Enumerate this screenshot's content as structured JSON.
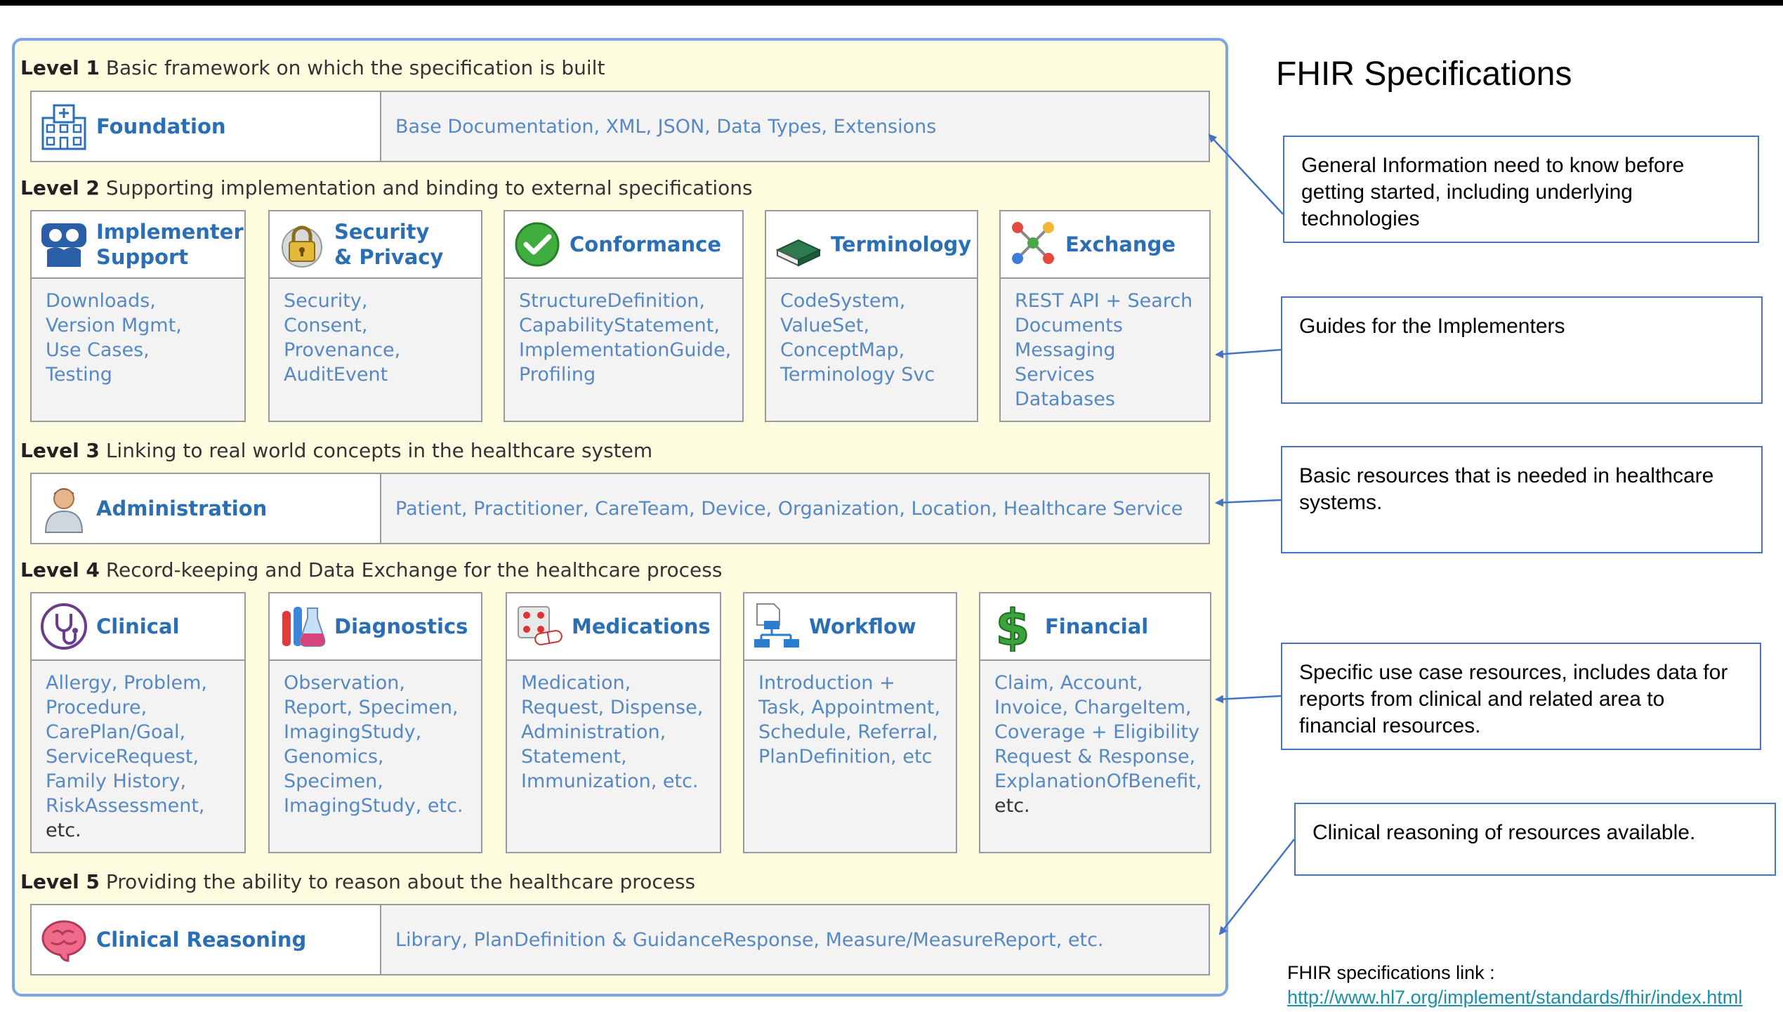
{
  "heading": "FHIR Specifications",
  "levels": [
    {
      "num": "Level 1",
      "text": "Basic framework on which the specification is built"
    },
    {
      "num": "Level 2",
      "text": "Supporting implementation and binding to external specifications"
    },
    {
      "num": "Level 3",
      "text": "Linking to real world concepts in the healthcare system"
    },
    {
      "num": "Level 4",
      "text": "Record-keeping and Data Exchange for the healthcare process"
    },
    {
      "num": "Level 5",
      "text": "Providing the ability to reason about the healthcare process"
    }
  ],
  "foundation": {
    "label": "Foundation",
    "icon": "building-icon",
    "items": "Base Documentation, XML, JSON, Data Types, Extensions"
  },
  "level2": [
    {
      "label1": "Implementer",
      "label2": "Support",
      "icon": "people-icon",
      "lines": [
        "Downloads,",
        "Version Mgmt,",
        "Use Cases,",
        "Testing"
      ]
    },
    {
      "label1": "Security",
      "label2": "& Privacy",
      "icon": "lock-icon",
      "lines": [
        "Security,",
        "Consent,",
        "Provenance,",
        "AuditEvent"
      ]
    },
    {
      "label1": "Conformance",
      "label2": "",
      "icon": "check-icon",
      "lines": [
        "StructureDefinition,",
        "CapabilityStatement,",
        "ImplementationGuide,",
        "Profiling"
      ]
    },
    {
      "label1": "Terminology",
      "label2": "",
      "icon": "book-icon",
      "lines": [
        "CodeSystem,",
        "ValueSet,",
        "ConceptMap,",
        "Terminology Svc"
      ]
    },
    {
      "label1": "Exchange",
      "label2": "",
      "icon": "exchange-icon",
      "lines": [
        "REST API + Search",
        "Documents",
        "Messaging",
        "Services",
        "Databases"
      ]
    }
  ],
  "administration": {
    "label": "Administration",
    "icon": "person-icon",
    "items": "Patient, Practitioner, CareTeam, Device, Organization, Location, Healthcare Service"
  },
  "level4": [
    {
      "label": "Clinical",
      "icon": "stethoscope-icon",
      "lines": [
        "Allergy, Problem,",
        "Procedure,",
        "CarePlan/Goal,",
        "ServiceRequest,",
        "Family History,",
        "RiskAssessment,",
        "etc."
      ]
    },
    {
      "label": "Diagnostics",
      "icon": "flask-icon",
      "lines": [
        "Observation,",
        "Report, Specimen,",
        "ImagingStudy,",
        "Genomics,",
        "Specimen,",
        "ImagingStudy, etc."
      ]
    },
    {
      "label": "Medications",
      "icon": "pills-icon",
      "lines": [
        "Medication,",
        "Request, Dispense,",
        "Administration,",
        "Statement,",
        "Immunization, etc."
      ]
    },
    {
      "label": "Workflow",
      "icon": "flowchart-icon",
      "lines": [
        "Introduction +",
        "Task, Appointment,",
        "Schedule, Referral,",
        "PlanDefinition, etc"
      ]
    },
    {
      "label": "Financial",
      "icon": "dollar-icon",
      "lines": [
        "Claim, Account,",
        "Invoice, ChargeItem,",
        "Coverage + Eligibility",
        "Request & Response,",
        "ExplanationOfBenefit,",
        "etc."
      ]
    }
  ],
  "reasoning": {
    "label": "Clinical Reasoning",
    "icon": "brain-icon",
    "items": "Library, PlanDefinition & GuidanceResponse, Measure/MeasureReport, etc."
  },
  "notes": [
    "General Information need to know before getting started, including underlying technologies",
    "Guides for the Implementers",
    "Basic resources that is needed in healthcare systems.",
    "Specific use case resources, includes data for reports from clinical and related area to financial resources.",
    "Clinical reasoning of resources available."
  ],
  "link_label": "FHIR specifications link :",
  "link_url": "http://www.hl7.org/implement/standards/fhir/index.html",
  "colors": {
    "panel": "#fffde0",
    "panel_border": "#7aa6e8",
    "link_text": "#5688c4",
    "title_blue": "#2a6fb5",
    "note_border": "#4472c4"
  }
}
